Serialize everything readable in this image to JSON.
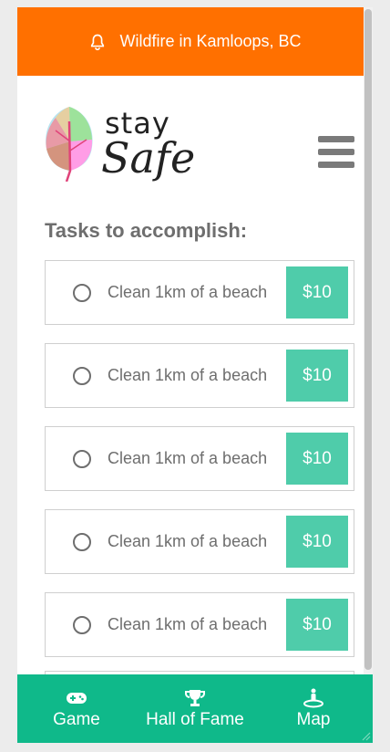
{
  "alert": {
    "text": "Wildfire in Kamloops, BC",
    "icon": "bell-icon"
  },
  "logo": {
    "line1": "stay",
    "line2": "Safe"
  },
  "menu": {
    "icon": "hamburger-menu-icon"
  },
  "tasks_section": {
    "title": "Tasks to accomplish:",
    "items": [
      {
        "label": "Clean 1km of a beach",
        "reward": "$10"
      },
      {
        "label": "Clean 1km of a beach",
        "reward": "$10"
      },
      {
        "label": "Clean 1km of a beach",
        "reward": "$10"
      },
      {
        "label": "Clean 1km of a beach",
        "reward": "$10"
      },
      {
        "label": "Clean 1km of a beach",
        "reward": "$10"
      }
    ]
  },
  "bottom_nav": {
    "items": [
      {
        "label": "Game",
        "icon": "gamepad-icon"
      },
      {
        "label": "Hall of Fame",
        "icon": "trophy-icon"
      },
      {
        "label": "Map",
        "icon": "map-person-icon"
      }
    ]
  },
  "colors": {
    "alert": "#ff7000",
    "reward": "#4fccaa",
    "nav": "#0fb98a",
    "text": "#6e6e6e"
  }
}
